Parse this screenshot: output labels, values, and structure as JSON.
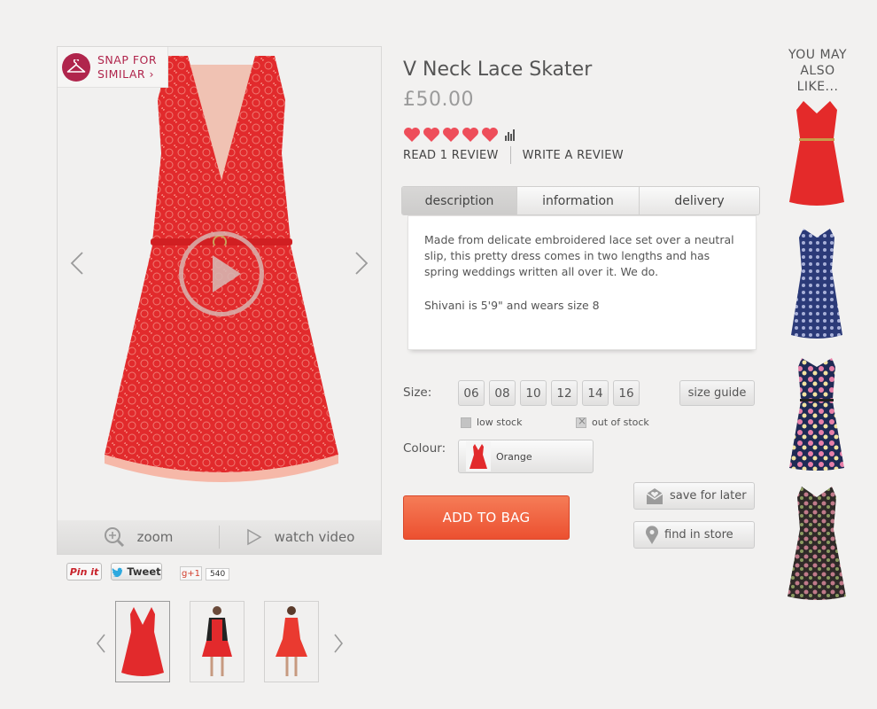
{
  "snap": {
    "line1": "SNAP FOR",
    "line2": "SIMILAR ›"
  },
  "image_bar": {
    "zoom": "zoom",
    "video": "watch video"
  },
  "social": {
    "pinterest": "Pin it",
    "tweet": "Tweet",
    "gplus": "g+1",
    "gplus_count": "540"
  },
  "product": {
    "title": "V Neck Lace Skater",
    "price": "£50.00",
    "rating": 5,
    "read_reviews": "READ 1 REVIEW",
    "write_review": "WRITE A REVIEW"
  },
  "tabs": {
    "description": "description",
    "information": "information",
    "delivery": "delivery"
  },
  "description": {
    "p1": "Made from delicate embroidered lace set over a neutral slip, this pretty dress comes in two lengths and has spring weddings written all over it. We do.",
    "p2": "Shivani is 5'9\" and wears size 8"
  },
  "size": {
    "label": "Size:",
    "options": [
      "06",
      "08",
      "10",
      "12",
      "14",
      "16"
    ],
    "guide": "size guide",
    "low_stock": "low stock",
    "out_of_stock": "out of stock"
  },
  "colour": {
    "label": "Colour:",
    "selected": "Orange"
  },
  "actions": {
    "add_to_bag": "ADD TO BAG",
    "save_for_later": "save for later",
    "find_in_store": "find in store"
  },
  "recommend": {
    "heading1": "YOU MAY",
    "heading2": "ALSO LIKE..."
  },
  "colors": {
    "accent": "#ec5030",
    "snap_brand": "#b0254c",
    "heart": "#ee4e5a",
    "dress_red": "#e0282a"
  }
}
